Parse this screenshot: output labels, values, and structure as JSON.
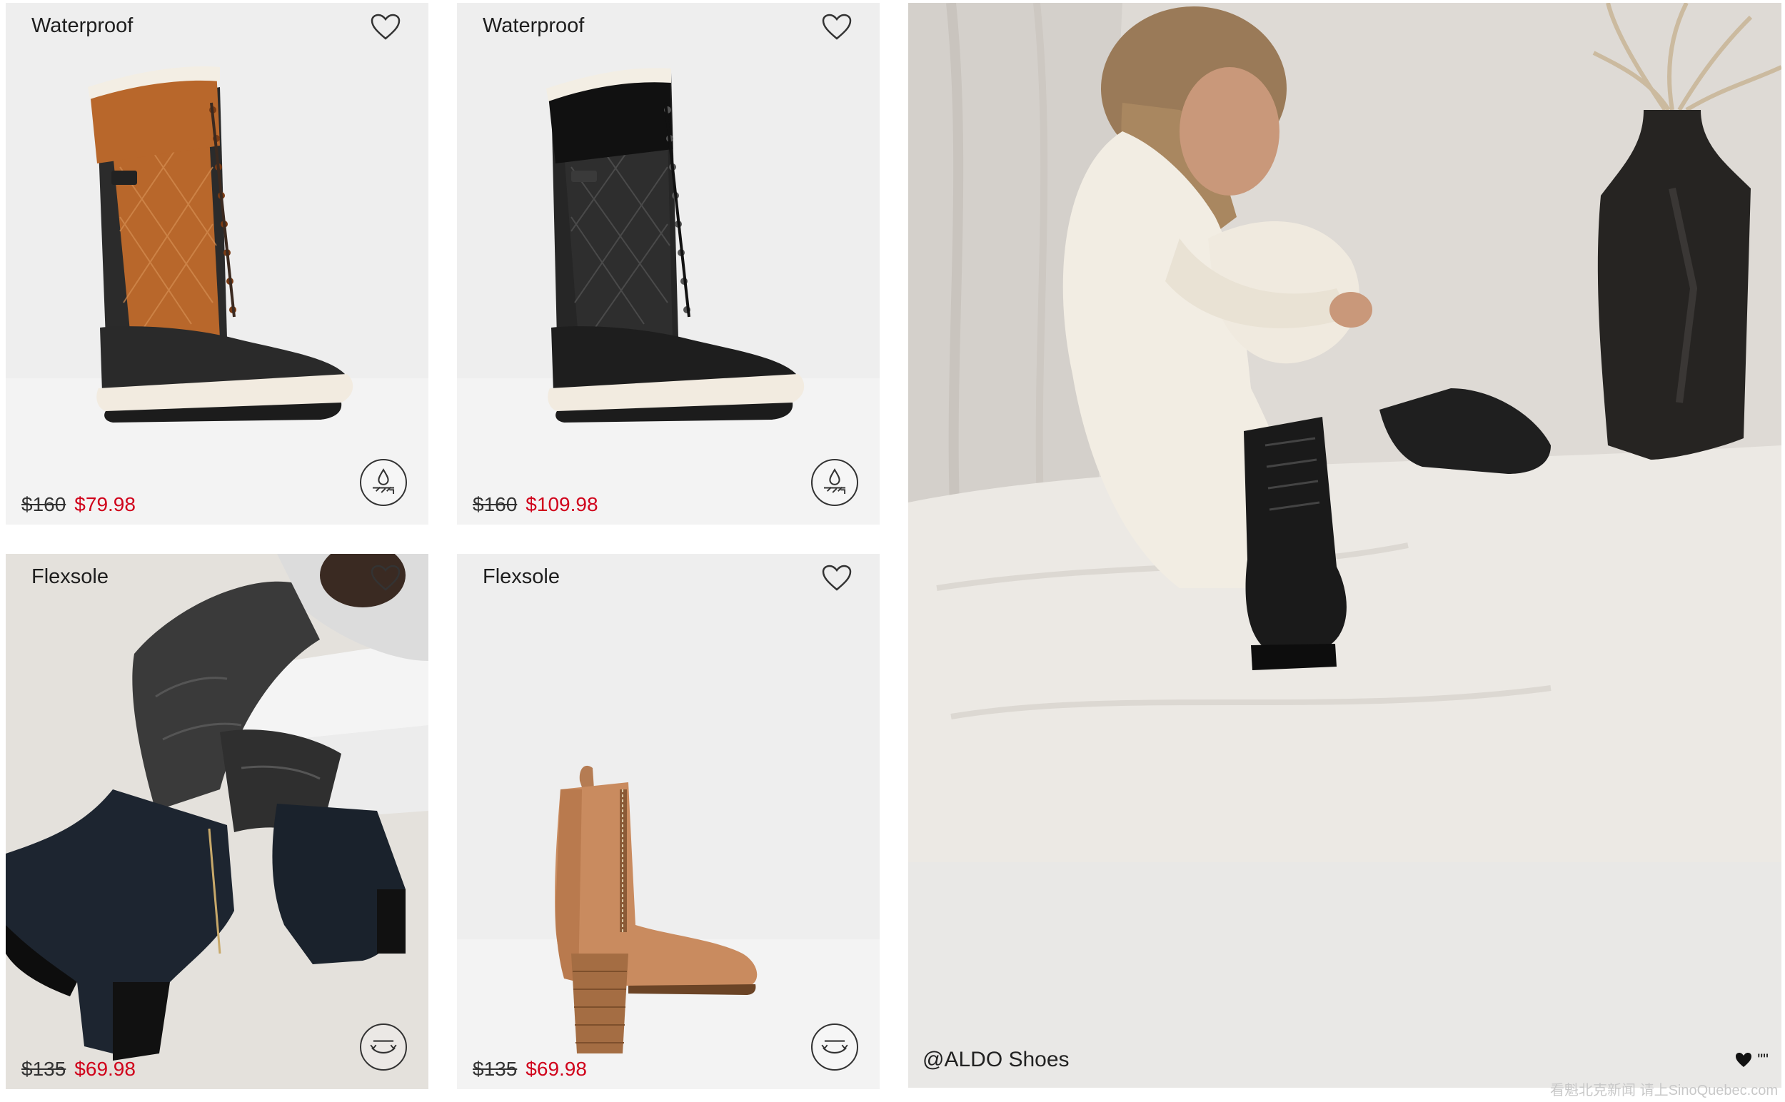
{
  "products": [
    {
      "tag": "Waterproof",
      "price_original": "$160",
      "price_sale": "$79.98",
      "colorway": "cognac",
      "feature_icon": "water-drop-icon"
    },
    {
      "tag": "Waterproof",
      "price_original": "$160",
      "price_sale": "$109.98",
      "colorway": "black",
      "feature_icon": "water-drop-icon"
    },
    {
      "tag": "Flexsole",
      "price_original": "$135",
      "price_sale": "$69.98",
      "colorway": "black-suede-lifestyle",
      "feature_icon": "flex-sole-icon"
    },
    {
      "tag": "Flexsole",
      "price_original": "$135",
      "price_sale": "$69.98",
      "colorway": "tan-leather",
      "feature_icon": "flex-sole-icon"
    }
  ],
  "ugc": {
    "handle": "@ALDO Shoes",
    "like_suffix": "\"\"",
    "watermark": "看魁北克新闻 请上SinoQuebec.com"
  },
  "colors": {
    "sale_price": "#d0021b",
    "card_bg": "#eeeeee",
    "panel_bg": "#e9e8e6"
  }
}
